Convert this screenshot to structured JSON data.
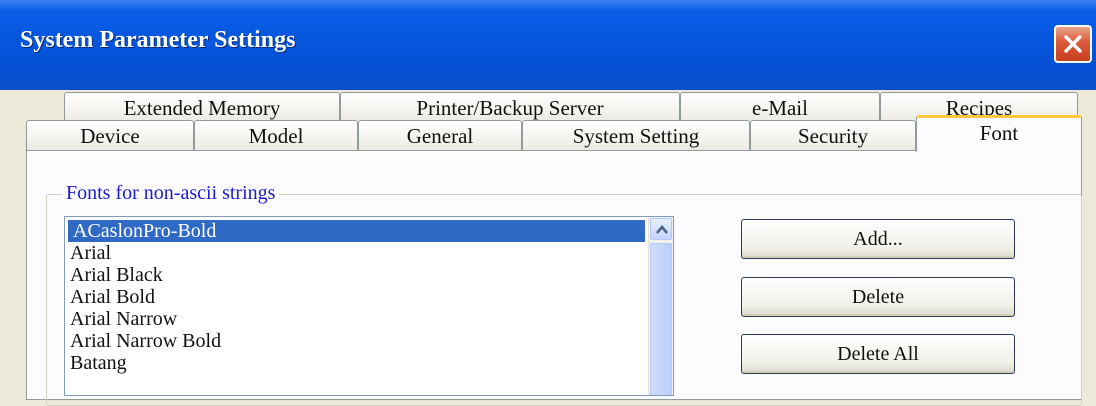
{
  "window": {
    "title": "System Parameter Settings",
    "close_icon": "close-icon"
  },
  "tabs": {
    "row_top": [
      {
        "label": "Extended Memory"
      },
      {
        "label": "Printer/Backup Server"
      },
      {
        "label": "e-Mail"
      },
      {
        "label": "Recipes"
      }
    ],
    "row_bottom": [
      {
        "label": "Device"
      },
      {
        "label": "Model"
      },
      {
        "label": "General"
      },
      {
        "label": "System Setting"
      },
      {
        "label": "Security"
      },
      {
        "label": "Font",
        "active": true
      }
    ]
  },
  "font_group": {
    "label": "Fonts for non-ascii strings",
    "fonts": [
      "ACaslonPro-Bold",
      "Arial",
      "Arial Black",
      "Arial Bold",
      "Arial Narrow",
      "Arial Narrow Bold",
      "Batang"
    ],
    "selected_font": "ACaslonPro-Bold"
  },
  "buttons": {
    "add": "Add...",
    "delete": "Delete",
    "delete_all": "Delete All"
  },
  "colors": {
    "titlebar": "#0657e0",
    "selection": "#316ac5",
    "active_tab_accent": "#ffc83c",
    "group_label": "#1b1bd0",
    "close_button": "#d9593a"
  }
}
